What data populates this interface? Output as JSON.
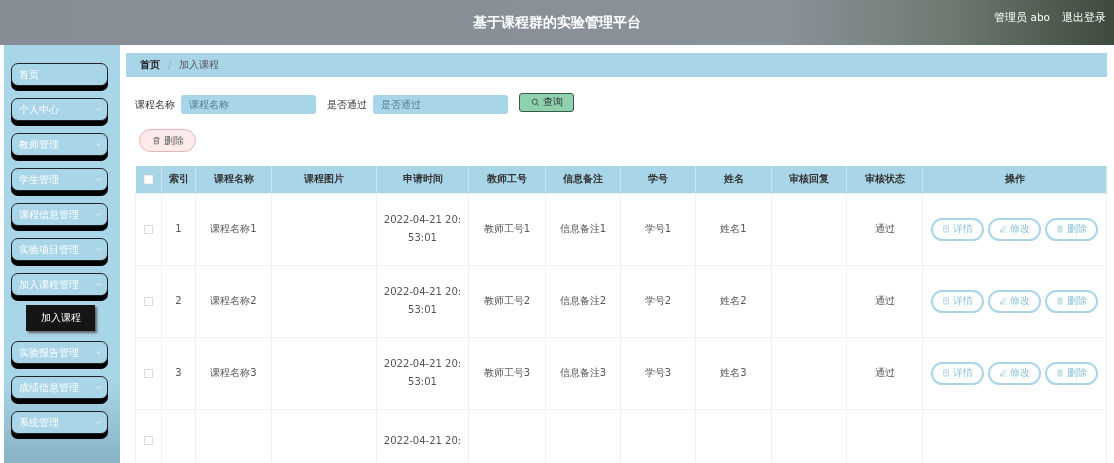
{
  "header": {
    "title": "基于课程群的实验管理平台",
    "user": "管理员 abo",
    "logout": "退出登录"
  },
  "sidebar": {
    "items": [
      {
        "label": "首页",
        "expandable": false
      },
      {
        "label": "个人中心",
        "expandable": true,
        "expanded": false
      },
      {
        "label": "教师管理",
        "expandable": true,
        "expanded": false
      },
      {
        "label": "学生管理",
        "expandable": true,
        "expanded": false
      },
      {
        "label": "课程信息管理",
        "expandable": true,
        "expanded": false
      },
      {
        "label": "实验项目管理",
        "expandable": true,
        "expanded": false
      },
      {
        "label": "加入课程管理",
        "expandable": true,
        "expanded": true,
        "children": [
          {
            "label": "加入课程",
            "selected": true
          }
        ]
      },
      {
        "label": "实验报告管理",
        "expandable": true,
        "expanded": false
      },
      {
        "label": "成绩信息管理",
        "expandable": true,
        "expanded": false
      },
      {
        "label": "系统管理",
        "expandable": true,
        "expanded": false
      }
    ]
  },
  "breadcrumb": {
    "items": [
      "首页",
      "加入课程"
    ],
    "separator": "/"
  },
  "search": {
    "fields": [
      {
        "label": "课程名称",
        "placeholder": "课程名称",
        "kind": "text"
      },
      {
        "label": "是否通过",
        "placeholder": "是否通过",
        "kind": "select"
      }
    ],
    "button": "查询"
  },
  "delete_button": "删除",
  "table": {
    "select_all_checked": false,
    "columns": [
      "索引",
      "课程名称",
      "课程图片",
      "申请时间",
      "教师工号",
      "信息备注",
      "学号",
      "姓名",
      "审核回复",
      "审核状态",
      "操作"
    ],
    "rows": [
      {
        "checked": false,
        "cells": [
          "1",
          "课程名称1",
          null,
          "2022-04-21 20:\n53:01",
          "教师工号1",
          "信息备注1",
          "学号1",
          "姓名1",
          null,
          "通过"
        ],
        "actions": [
          "详情",
          "修改",
          "删除"
        ]
      },
      {
        "checked": false,
        "cells": [
          "2",
          "课程名称2",
          null,
          "2022-04-21 20:\n53:01",
          "教师工号2",
          "信息备注2",
          "学号2",
          "姓名2",
          null,
          "通过"
        ],
        "actions": [
          "详情",
          "修改",
          "删除"
        ]
      },
      {
        "checked": false,
        "cells": [
          "3",
          "课程名称3",
          null,
          "2022-04-21 20:\n53:01",
          "教师工号3",
          "信息备注3",
          "学号3",
          "姓名3",
          null,
          "通过"
        ],
        "actions": [
          "详情",
          "修改",
          "删除"
        ]
      },
      {
        "checked": false,
        "cells": [
          null,
          null,
          null,
          "2022-04-21 20:",
          null,
          null,
          null,
          null,
          null,
          null
        ]
      }
    ]
  }
}
